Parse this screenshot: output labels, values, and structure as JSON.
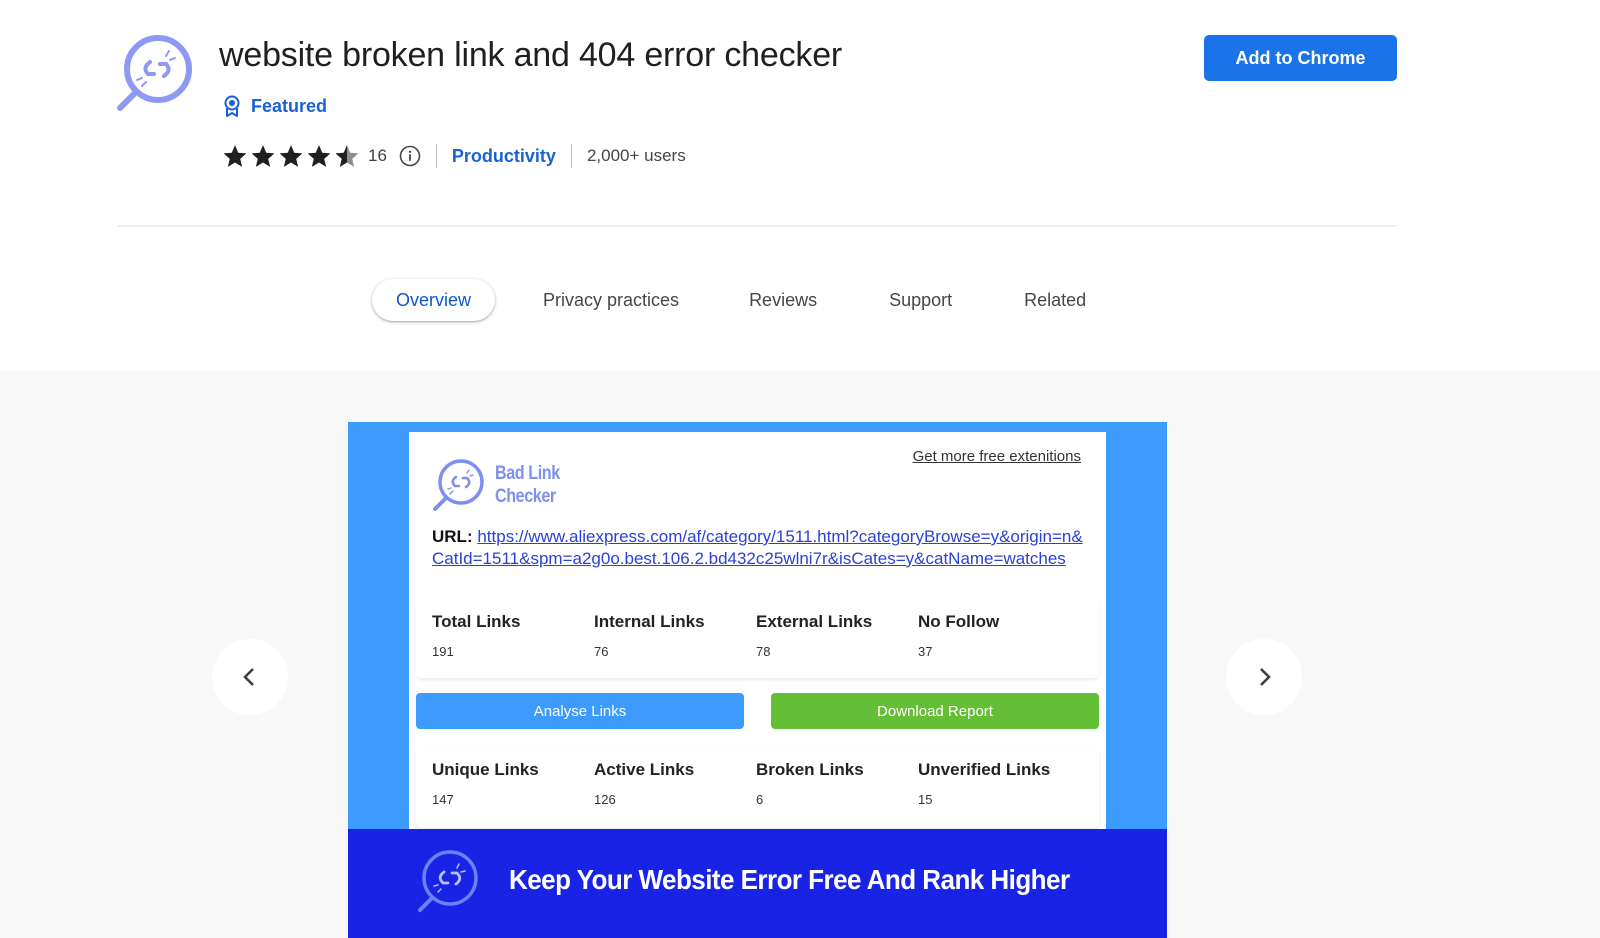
{
  "header": {
    "title": "website broken link and 404 error checker",
    "featured_label": "Featured",
    "rating": 4.5,
    "rating_max": 5,
    "rating_count": "16",
    "category": "Productivity",
    "users": "2,000+ users",
    "add_button": "Add to Chrome"
  },
  "tabs": [
    {
      "label": "Overview",
      "active": true
    },
    {
      "label": "Privacy practices",
      "active": false
    },
    {
      "label": "Reviews",
      "active": false
    },
    {
      "label": "Support",
      "active": false
    },
    {
      "label": "Related",
      "active": false
    }
  ],
  "screenshot": {
    "more_link": "Get more free extenitions",
    "logo_line1": "Bad Link",
    "logo_line2": "Checker",
    "url_label": "URL:",
    "url": "https://www.aliexpress.com/af/category/1511.html?categoryBrowse=y&origin=n&CatId=1511&spm=a2g0o.best.106.2.bd432c25wlni7r&isCates=y&catName=watches",
    "stats_top": [
      {
        "label": "Total Links",
        "value": "191"
      },
      {
        "label": "Internal Links",
        "value": "76"
      },
      {
        "label": "External Links",
        "value": "78"
      },
      {
        "label": "No Follow",
        "value": "37"
      }
    ],
    "analyse_button": "Analyse Links",
    "download_button": "Download Report",
    "stats_bottom": [
      {
        "label": "Unique Links",
        "value": "147"
      },
      {
        "label": "Active Links",
        "value": "126"
      },
      {
        "label": "Broken Links",
        "value": "6"
      },
      {
        "label": "Unverified Links",
        "value": "15"
      }
    ],
    "banner_text": "Keep Your Website Error Free And Rank Higher"
  },
  "colors": {
    "accent": "#1a73e8",
    "link": "#1a61d5",
    "screenshot_bg": "#3d9bfd",
    "banner_bg": "#1923e6",
    "download_green": "#64be36",
    "logo_purple": "#7f8ff0"
  },
  "icons": {
    "app": "broken-link-magnifier-icon",
    "featured": "award-badge-icon",
    "info": "info-icon",
    "prev": "chevron-left-icon",
    "next": "chevron-right-icon"
  }
}
